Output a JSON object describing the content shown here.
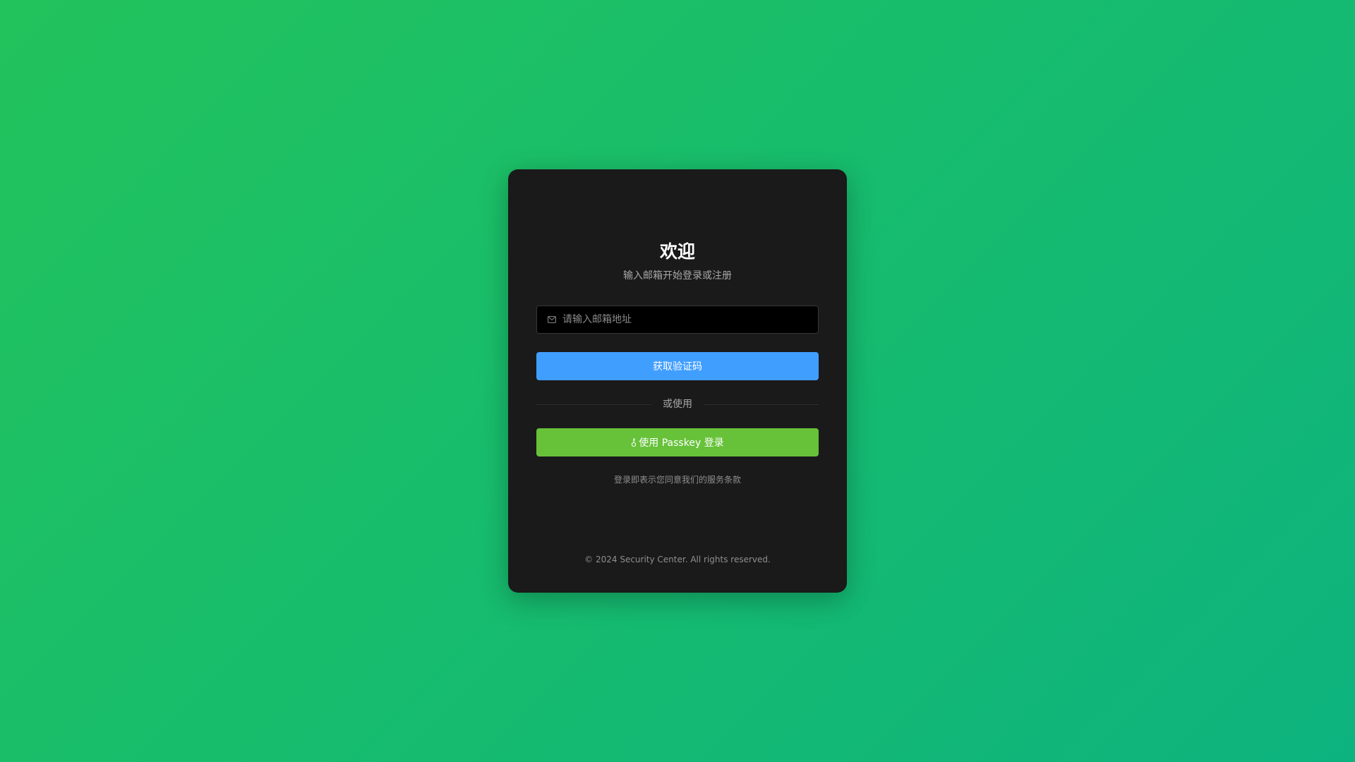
{
  "login": {
    "title": "欢迎",
    "subtitle": "输入邮箱开始登录或注册",
    "email": {
      "placeholder": "请输入邮箱地址",
      "value": ""
    },
    "get_code_label": "获取验证码",
    "divider_text": "或使用",
    "passkey_label": "使用 Passkey 登录",
    "terms_text": "登录即表示您同意我们的服务条款"
  },
  "footer": {
    "copyright": "© 2024 Security Center. All rights reserved."
  },
  "icons": {
    "email": "mail-icon",
    "passkey": "key-icon"
  },
  "colors": {
    "background_start": "#22c35c",
    "background_end": "#0db37e",
    "card": "#1a1a1a",
    "primary_button": "#409eff",
    "passkey_button": "#67c23a"
  }
}
